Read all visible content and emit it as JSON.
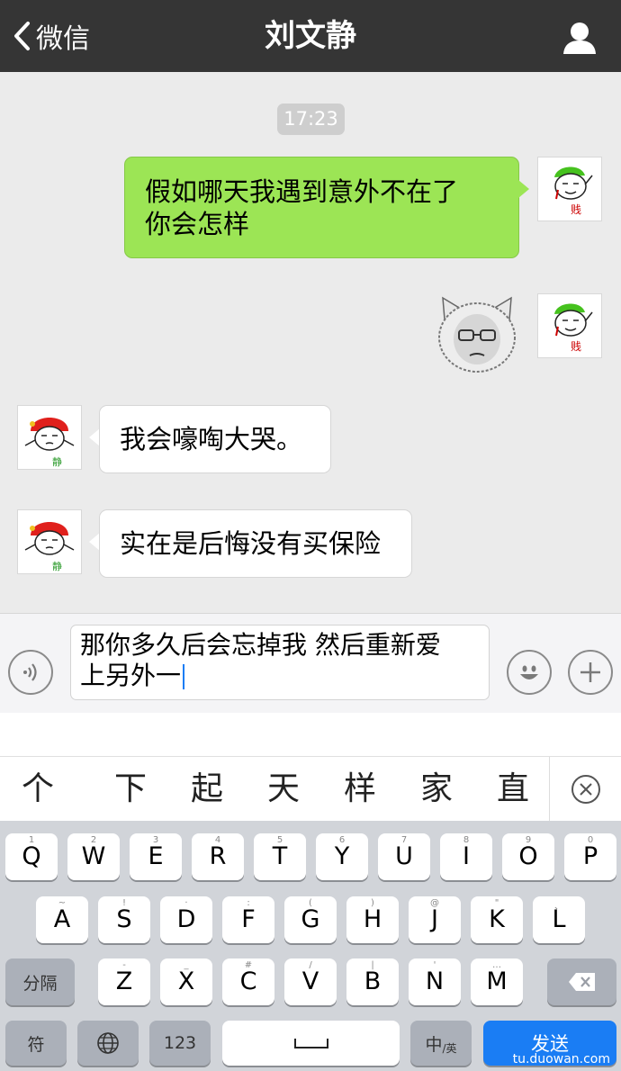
{
  "nav": {
    "back_label": "微信",
    "title": "刘文静"
  },
  "chat": {
    "timestamp": "17:23",
    "messages": [
      {
        "side": "out",
        "type": "text",
        "text_line1": "假如哪天我遇到意外不在了",
        "text_line2": "你会怎样"
      },
      {
        "side": "out",
        "type": "sticker"
      },
      {
        "side": "in",
        "type": "text",
        "text": "我会嚎啕大哭。"
      },
      {
        "side": "in",
        "type": "text",
        "text": "实在是后悔没有买保险"
      }
    ],
    "avatar_self_label": "贱",
    "avatar_other_label": "静"
  },
  "input": {
    "line1": "那你多久后会忘掉我  然后重新爱",
    "line2": "上另外一"
  },
  "candidates": [
    "个",
    "下",
    "起",
    "天",
    "样",
    "家",
    "直"
  ],
  "keyboard": {
    "row1": [
      {
        "k": "Q",
        "h": "1"
      },
      {
        "k": "W",
        "h": "2"
      },
      {
        "k": "E",
        "h": "3"
      },
      {
        "k": "R",
        "h": "4"
      },
      {
        "k": "T",
        "h": "5"
      },
      {
        "k": "Y",
        "h": "6"
      },
      {
        "k": "U",
        "h": "7"
      },
      {
        "k": "I",
        "h": "8"
      },
      {
        "k": "O",
        "h": "9"
      },
      {
        "k": "P",
        "h": "0"
      }
    ],
    "row2": [
      {
        "k": "A",
        "h": "~"
      },
      {
        "k": "S",
        "h": "!"
      },
      {
        "k": "D",
        "h": "·"
      },
      {
        "k": "F",
        "h": ":"
      },
      {
        "k": "G",
        "h": "("
      },
      {
        "k": "H",
        "h": ")"
      },
      {
        "k": "J",
        "h": "@"
      },
      {
        "k": "K",
        "h": "\""
      },
      {
        "k": "L",
        "h": "、"
      }
    ],
    "row3": [
      {
        "k": "Z",
        "h": "-"
      },
      {
        "k": "X",
        "h": "_"
      },
      {
        "k": "C",
        "h": "#"
      },
      {
        "k": "V",
        "h": "/"
      },
      {
        "k": "B",
        "h": "|"
      },
      {
        "k": "N",
        "h": "'"
      },
      {
        "k": "M",
        "h": "…"
      }
    ],
    "separator_label": "分隔",
    "symbol_label": "符",
    "numbers_label": "123",
    "lang_label": "中",
    "lang_sub_label": "/英",
    "send_label": "发送"
  },
  "watermark": "tu.duowan.com",
  "colors": {
    "navbar": "#353535",
    "bubble_out": "#9ce555",
    "send_key": "#1a7df4"
  },
  "icons": [
    "chevron-left-icon",
    "person-icon",
    "voice-icon",
    "emoji-icon",
    "plus-icon",
    "clear-candidate-icon",
    "globe-icon",
    "backspace-icon",
    "space-icon"
  ]
}
